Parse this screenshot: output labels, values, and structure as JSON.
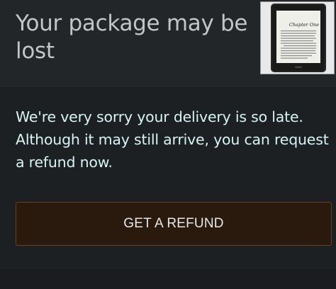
{
  "header": {
    "title": "Your package may be lost"
  },
  "product": {
    "image_name": "kindle-ereader-image",
    "screen_heading": "Chapter One"
  },
  "message": {
    "text": "We're very sorry your delivery is so late. Although it may still arrive, you can request a refund now."
  },
  "actions": {
    "refund_label": "GET A REFUND"
  },
  "colors": {
    "background": "#1d2023",
    "header_background": "#232629",
    "title_text": "#c3c6c8",
    "message_text": "#d8f3f5",
    "button_fill": "#2a1a0e",
    "button_border": "#6a4020"
  }
}
